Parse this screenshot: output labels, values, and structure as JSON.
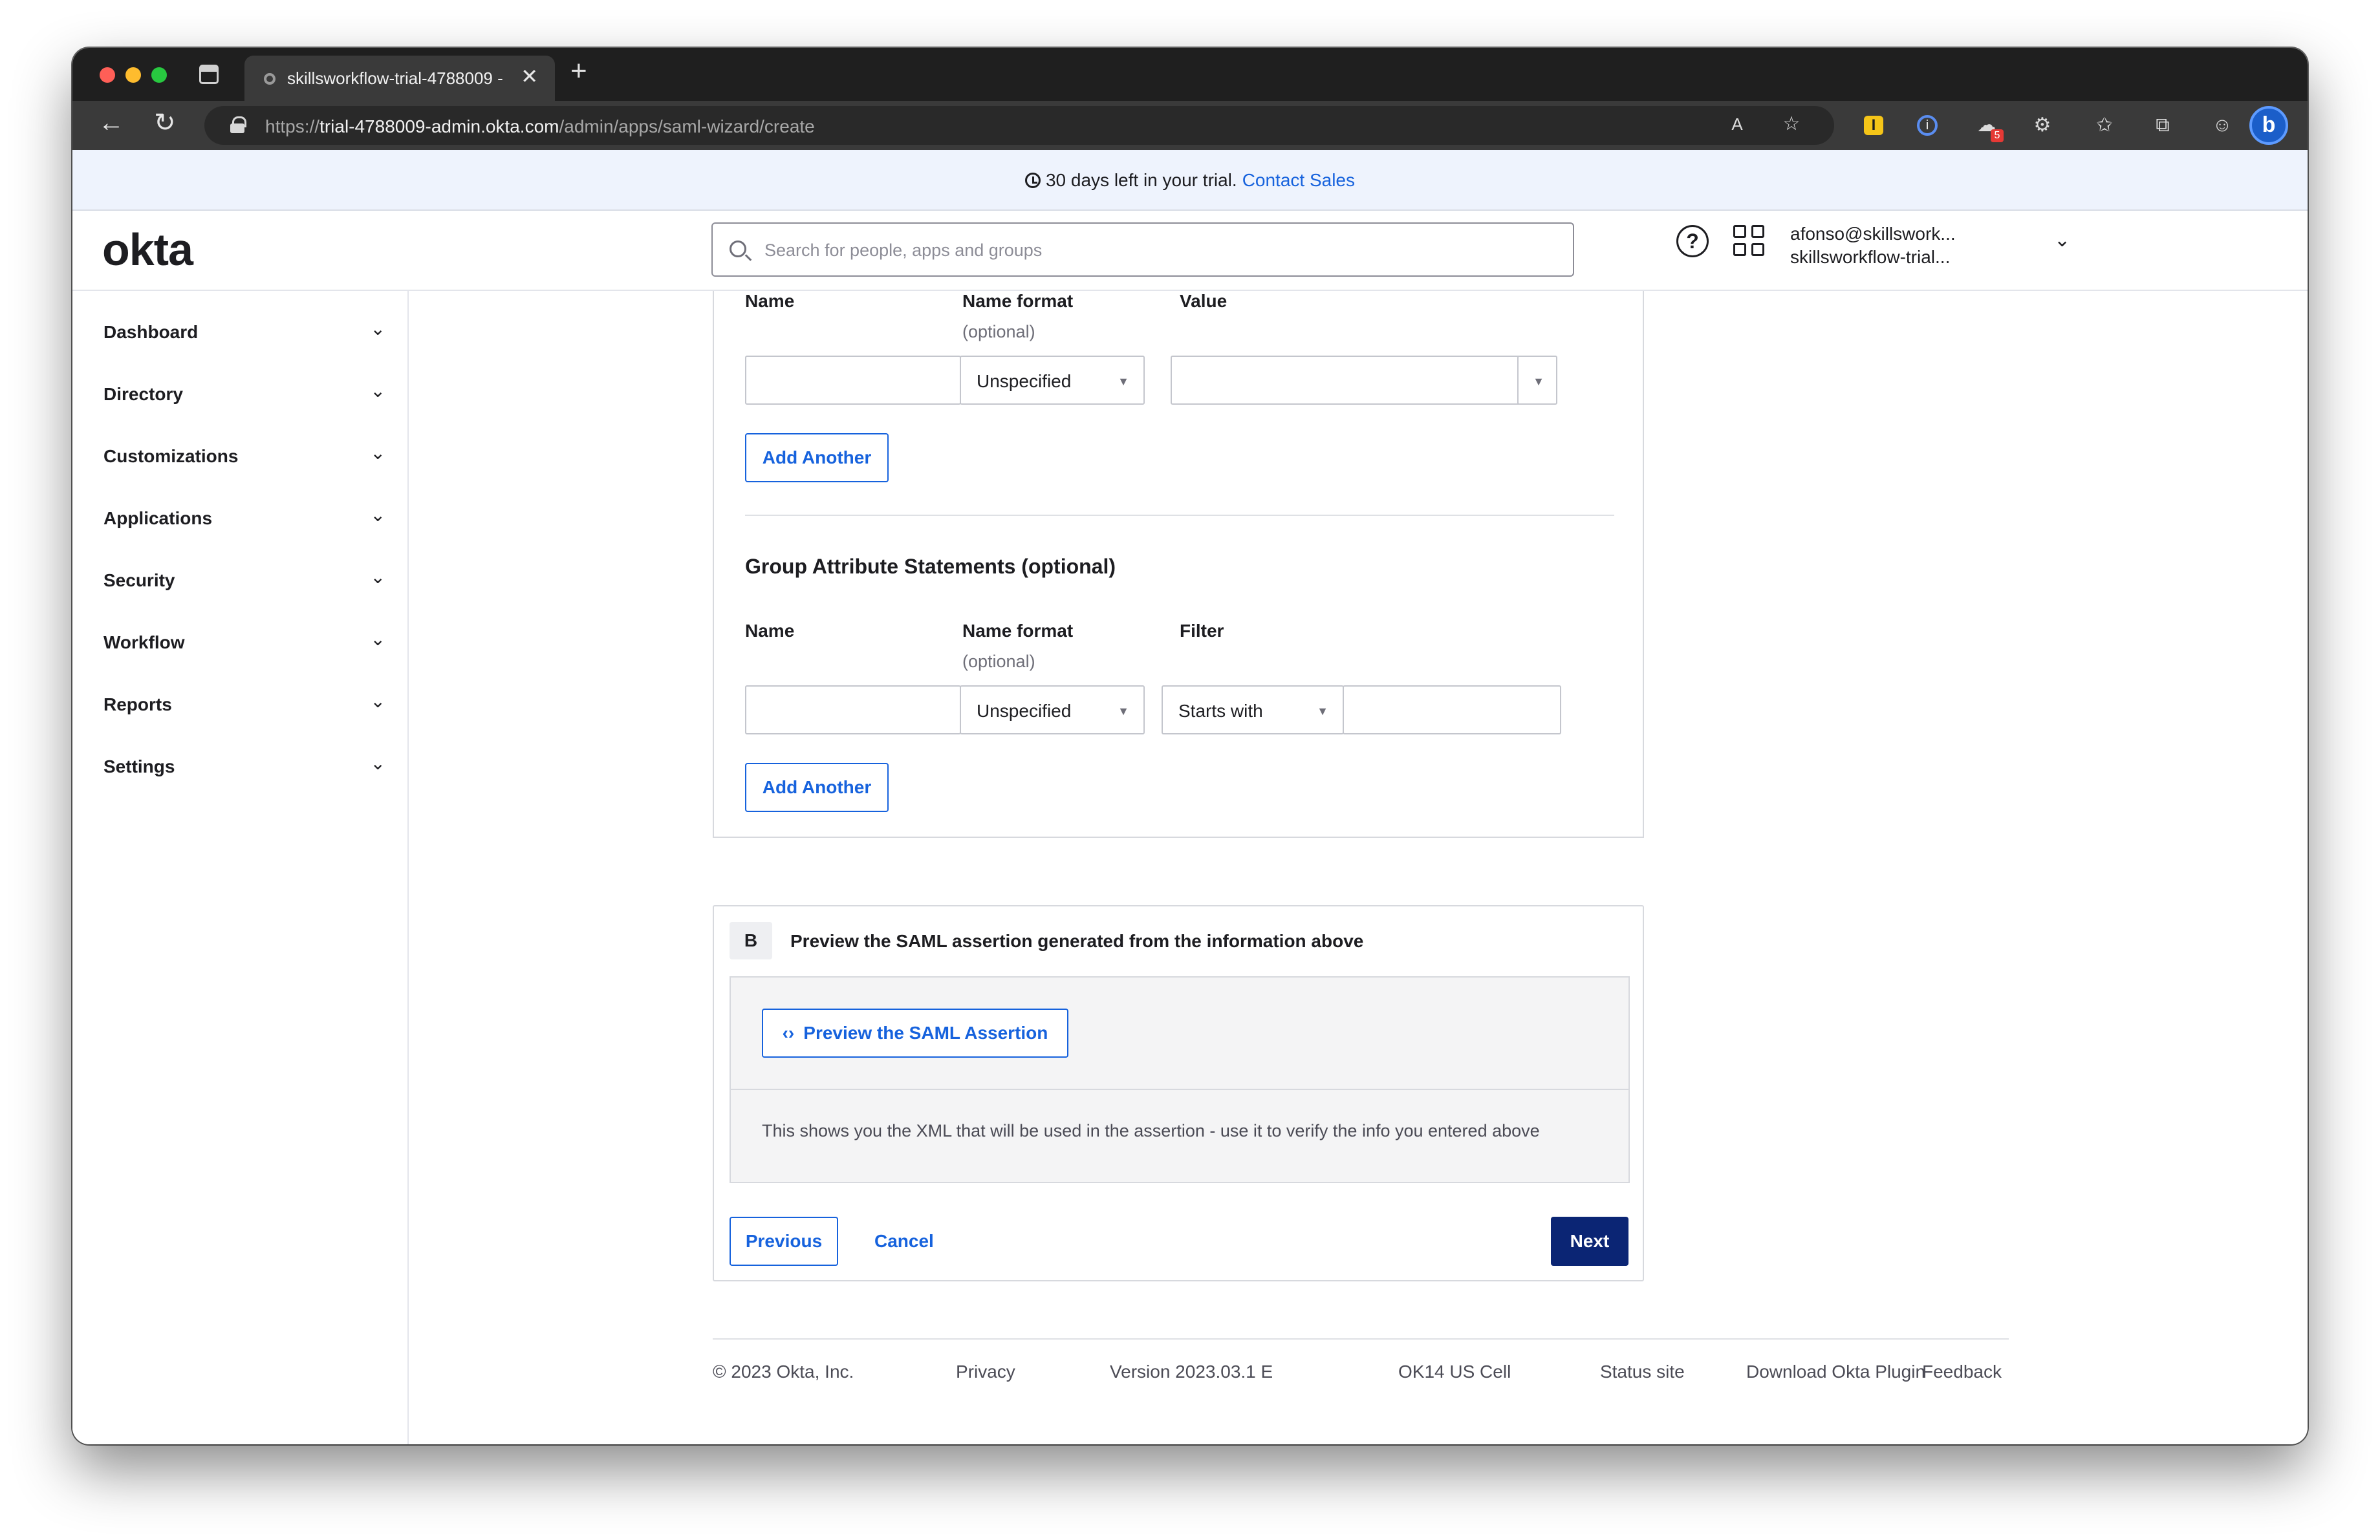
{
  "browser": {
    "tab_title": "skillsworkflow-trial-4788009 -",
    "tab_close": "✕",
    "new_tab": "+",
    "url_scheme": "https://",
    "url_host": "trial-4788009-admin.okta.com",
    "url_path": "/admin/apps/saml-wizard/create",
    "extension_badge": "5"
  },
  "banner": {
    "text": "30 days left in your trial.",
    "link": "Contact Sales"
  },
  "header": {
    "logo": "okta",
    "search_placeholder": "Search for people, apps and groups",
    "user_email": "afonso@skillswork...",
    "user_org": "skillsworkflow-trial..."
  },
  "sidebar": {
    "items": [
      {
        "label": "Dashboard"
      },
      {
        "label": "Directory"
      },
      {
        "label": "Customizations"
      },
      {
        "label": "Applications"
      },
      {
        "label": "Security"
      },
      {
        "label": "Workflow"
      },
      {
        "label": "Reports"
      },
      {
        "label": "Settings"
      }
    ]
  },
  "attribute_statements": {
    "col_name": "Name",
    "col_format": "Name format",
    "col_format_sub": "(optional)",
    "col_value": "Value",
    "name_value": "",
    "format_value": "Unspecified",
    "value_value": "",
    "add_another": "Add Another"
  },
  "group_statements": {
    "title": "Group Attribute Statements (optional)",
    "col_name": "Name",
    "col_format": "Name format",
    "col_format_sub": "(optional)",
    "col_filter": "Filter",
    "name_value": "",
    "format_value": "Unspecified",
    "filter_type": "Starts with",
    "filter_value": "",
    "add_another": "Add Another"
  },
  "section_b": {
    "badge": "B",
    "title": "Preview the SAML assertion generated from the information above",
    "preview_button": "Preview the SAML Assertion",
    "preview_icon": "‹›",
    "description": "This shows you the XML that will be used in the assertion - use it to verify the info you entered above",
    "previous": "Previous",
    "cancel": "Cancel",
    "next": "Next"
  },
  "footer": {
    "copyright": "© 2023 Okta, Inc.",
    "privacy": "Privacy",
    "version": "Version 2023.03.1 E",
    "cell": "OK14 US Cell",
    "status": "Status site",
    "plugin": "Download Okta Plugin",
    "feedback": "Feedback"
  },
  "colors": {
    "accent": "#1662dd",
    "primary_button": "#0b2574",
    "banner_bg": "#eef3fd"
  }
}
